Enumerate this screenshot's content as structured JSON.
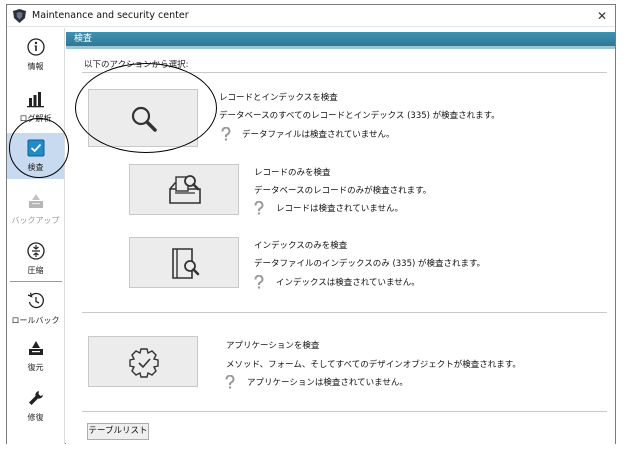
{
  "window": {
    "title": "Maintenance and security center",
    "close_glyph": "✕"
  },
  "sidebar": {
    "items": [
      {
        "label": "情報",
        "icon": "info-icon"
      },
      {
        "label": "ログ解析",
        "icon": "bar-chart-icon"
      },
      {
        "label": "検査",
        "icon": "checkbox-icon",
        "active": true
      },
      {
        "label": "バックアップ",
        "icon": "backup-icon",
        "disabled": true
      },
      {
        "label": "圧縮",
        "icon": "compress-icon"
      },
      {
        "label": "ロールバック",
        "icon": "rollback-icon"
      },
      {
        "label": "復元",
        "icon": "restore-icon"
      },
      {
        "label": "修復",
        "icon": "repair-icon"
      }
    ]
  },
  "main": {
    "header": "検査",
    "subtitle": "以下のアクションから選択:",
    "actions": [
      {
        "title": "レコードとインデックスを検査",
        "description": "データベースのすべてのレコードとインデックス (335) が検査されます。",
        "status": "データファイルは検査されていません。",
        "icon": "magnifier-icon"
      },
      {
        "title": "レコードのみを検査",
        "description": "データベースのレコードのみが検査されます。",
        "status": "レコードは検査されていません。",
        "icon": "tray-magnifier-icon"
      },
      {
        "title": "インデックスのみを検査",
        "description": "データファイルのインデックスのみ (335) が検査されます。",
        "status": "インデックスは検査されていません。",
        "icon": "book-magnifier-icon"
      },
      {
        "title": "アプリケーションを検査",
        "description": "メソッド、フォーム、そしてすべてのデザインオブジェクトが検査されます。",
        "status": "アプリケーションは検査されていません。",
        "icon": "gear-check-icon"
      }
    ],
    "table_list_button": "テーブルリスト"
  },
  "colors": {
    "header_bar": "#2d7896",
    "active_sidebar": "#c8daf0",
    "button_face": "#ececec"
  }
}
